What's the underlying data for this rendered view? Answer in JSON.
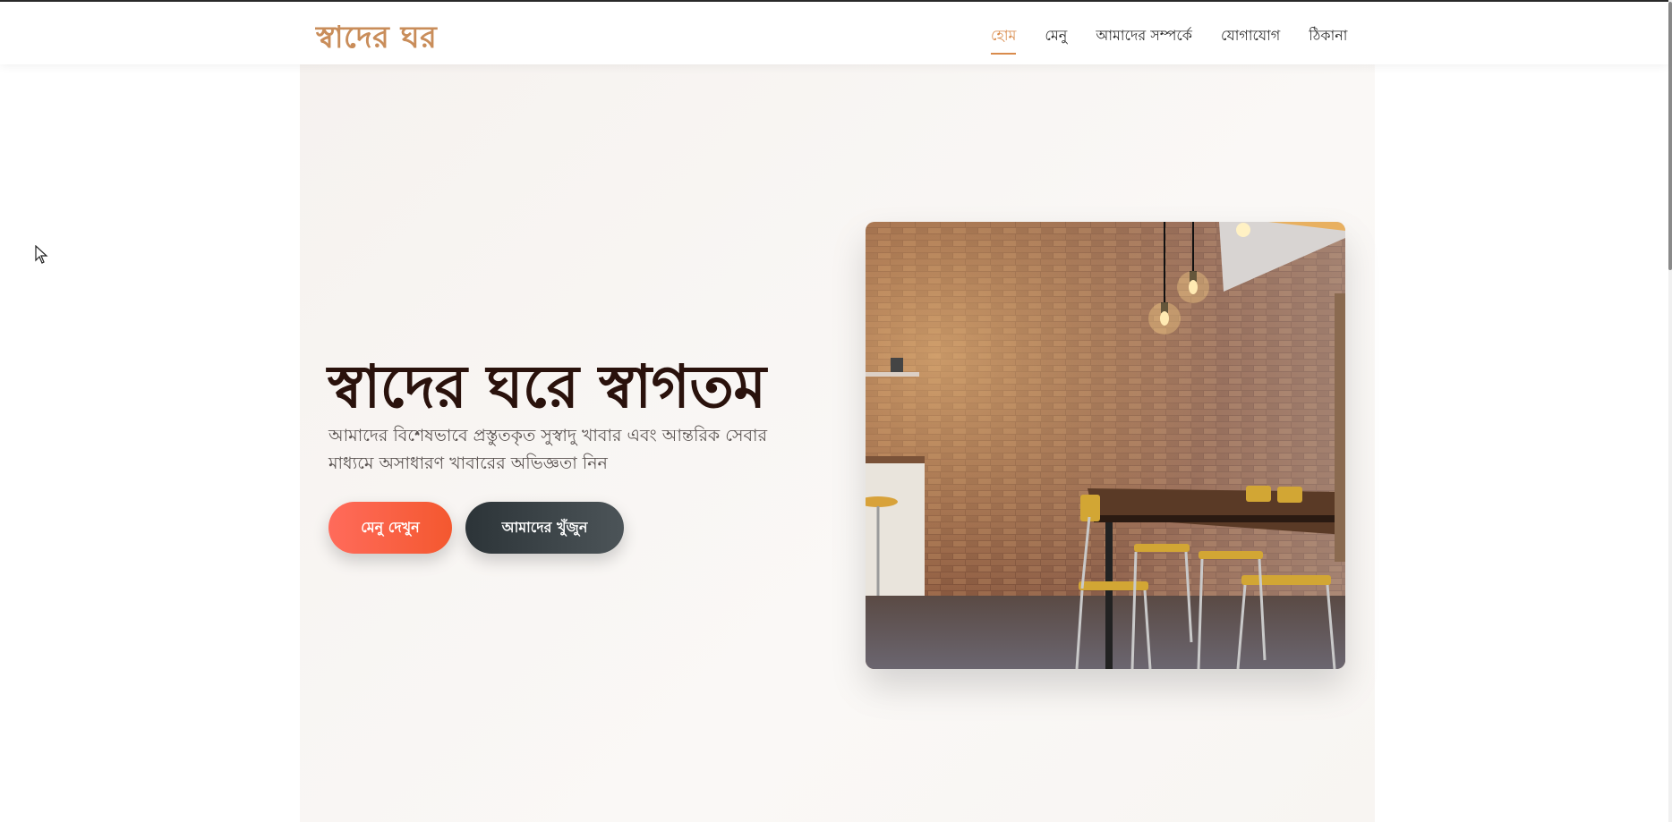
{
  "header": {
    "logo": "স্বাদের ঘর",
    "nav": [
      {
        "label": "হোম",
        "active": true
      },
      {
        "label": "মেনু",
        "active": false
      },
      {
        "label": "আমাদের সম্পর্কে",
        "active": false
      },
      {
        "label": "যোগাযোগ",
        "active": false
      },
      {
        "label": "ঠিকানা",
        "active": false
      }
    ]
  },
  "hero": {
    "title": "স্বাদের ঘরে স্বাগতম",
    "subtitle": "আমাদের বিশেষভাবে প্রস্তুতকৃত সুস্বাদু খাবার এবং আন্তরিক সেবার মাধ্যমে অসাধারণ খাবারের অভিজ্ঞতা নিন",
    "primary_button": "মেনু দেখুন",
    "secondary_button": "আমাদের খুঁজুন"
  },
  "colors": {
    "accent": "#d98b4c",
    "logo": "#c98d5a",
    "title": "#2a120c",
    "primary_button": "#f4582f",
    "secondary_button": "#2c3438"
  }
}
